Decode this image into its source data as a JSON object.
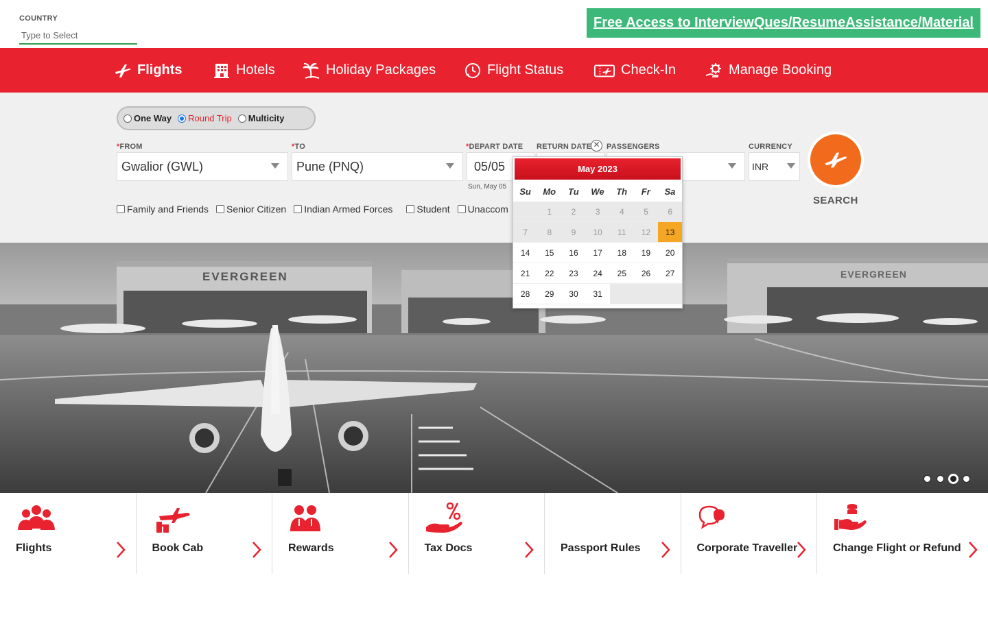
{
  "topbar": {
    "country_label": "COUNTRY",
    "country_placeholder": "Type to Select",
    "promo_link": "Free Access to InterviewQues/ResumeAssistance/Material"
  },
  "nav": [
    {
      "label": "Flights",
      "icon": "plane-icon",
      "active": true
    },
    {
      "label": "Hotels",
      "icon": "hotel-icon",
      "active": false
    },
    {
      "label": "Holiday Packages",
      "icon": "palm-tree-icon",
      "active": false
    },
    {
      "label": "Flight Status",
      "icon": "clock-icon",
      "active": false
    },
    {
      "label": "Check-In",
      "icon": "ticket-icon",
      "active": false
    },
    {
      "label": "Manage Booking",
      "icon": "gear-hand-icon",
      "active": false
    }
  ],
  "trip_types": [
    {
      "label": "One Way",
      "checked": false
    },
    {
      "label": "Round Trip",
      "checked": true
    },
    {
      "label": "Multicity",
      "checked": false
    }
  ],
  "fields": {
    "from_label": "FROM",
    "from_value": "Gwalior (GWL)",
    "to_label": "TO",
    "to_value": "Pune (PNQ)",
    "depart_label": "DEPART DATE",
    "depart_value": "05/05",
    "depart_sub": "Sun, May 05",
    "return_label": "RETURN DATE",
    "passengers_label": "PASSENGERS",
    "currency_label": "CURRENCY",
    "currency_value": "INR",
    "clear_symbol": "✕"
  },
  "search": {
    "label": "SEARCH"
  },
  "discounts": [
    "Family and Friends",
    "Senior Citizen",
    "Indian Armed Forces",
    "Student",
    "Unaccom"
  ],
  "calendar": {
    "month_label": "May 2023",
    "weekdays": [
      "Su",
      "Mo",
      "Tu",
      "We",
      "Th",
      "Fr",
      "Sa"
    ],
    "leading_empty": 1,
    "days": 31,
    "disabled_through": 12,
    "highlighted": 13
  },
  "hero": {
    "hangar_text": "EVERGREEN",
    "slides": 4,
    "active_slide": 3
  },
  "tiles": [
    {
      "label": "Flights",
      "icon": "people-icon"
    },
    {
      "label": "Book Cab",
      "icon": "cab-luggage-icon"
    },
    {
      "label": "Rewards",
      "icon": "rewards-people-icon"
    },
    {
      "label": "Tax Docs",
      "icon": "percent-hand-icon"
    },
    {
      "label": "Passport Rules",
      "icon": ""
    },
    {
      "label": "Corporate Traveller",
      "icon": "chat-bubbles-icon"
    },
    {
      "label": "Change Flight or Refund",
      "icon": "coins-hand-icon"
    }
  ],
  "colors": {
    "brand_red": "#e8222e",
    "accent_orange": "#f26b1d",
    "promo_green": "#3cb878",
    "today_yellow": "#f5a623"
  }
}
